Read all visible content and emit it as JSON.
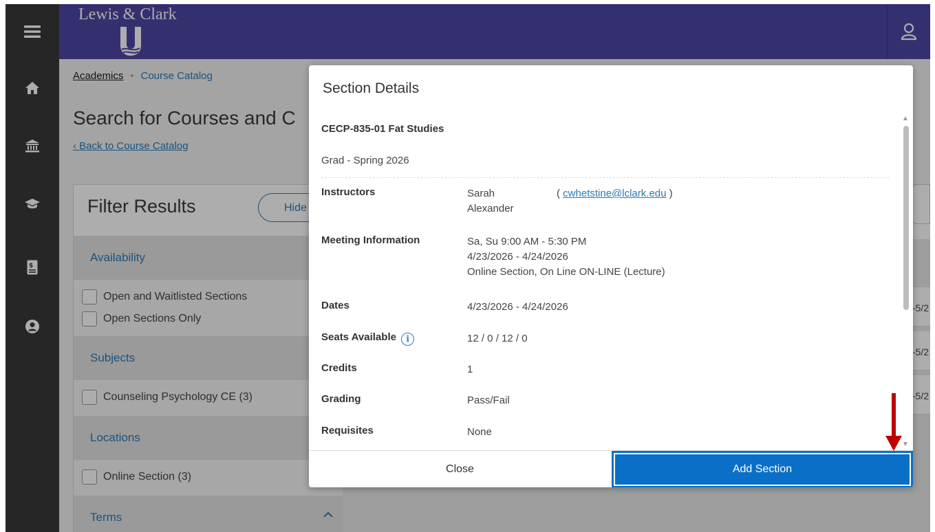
{
  "header": {
    "brand": "Lewis & Clark"
  },
  "breadcrumb": {
    "root": "Academics",
    "current": "Course Catalog"
  },
  "page": {
    "title": "Search for Courses and C",
    "back_link": "Back to Course Catalog"
  },
  "filters": {
    "title": "Filter Results",
    "hide_label": "Hide",
    "availability": {
      "title": "Availability",
      "options": [
        "Open and Waitlisted Sections",
        "Open Sections Only"
      ]
    },
    "subjects": {
      "title": "Subjects",
      "options": [
        "Counseling Psychology CE (3)"
      ]
    },
    "locations": {
      "title": "Locations",
      "options": [
        "Online Section (3)"
      ]
    },
    "terms": {
      "title": "Terms"
    }
  },
  "background_dates": [
    "-5/2",
    "-5/2",
    "-5/2"
  ],
  "modal": {
    "title": "Section Details",
    "course_name": "CECP-835-01 Fat Studies",
    "term": "Grad - Spring 2026",
    "details": {
      "instructors": {
        "label": "Instructors",
        "name": "Sarah Alexander",
        "email": "cwhetstine@lclark.edu"
      },
      "meeting": {
        "label": "Meeting Information",
        "days_time": "Sa, Su 9:00 AM - 5:30 PM",
        "dates": "4/23/2026 - 4/24/2026",
        "location": "Online Section, On Line ON-LINE (Lecture)"
      },
      "dates": {
        "label": "Dates",
        "value": "4/23/2026 - 4/24/2026"
      },
      "seats": {
        "label": "Seats Available",
        "value": "12 / 0 / 12 / 0"
      },
      "credits": {
        "label": "Credits",
        "value": "1"
      },
      "grading": {
        "label": "Grading",
        "value": "Pass/Fail"
      },
      "requisites": {
        "label": "Requisites",
        "value": "None"
      }
    },
    "close_label": "Close",
    "add_label": "Add Section"
  },
  "colors": {
    "header": "#4d47a6",
    "sidebar": "#383838",
    "primary": "#0a6fc6",
    "link": "#2a7ab8",
    "annotation": "#c00000"
  },
  "icons": {
    "sidebar": [
      "menu-icon",
      "home-icon",
      "bank-icon",
      "graduation-cap-icon",
      "dollar-document-icon",
      "user-circle-icon"
    ],
    "header": "user-icon"
  }
}
